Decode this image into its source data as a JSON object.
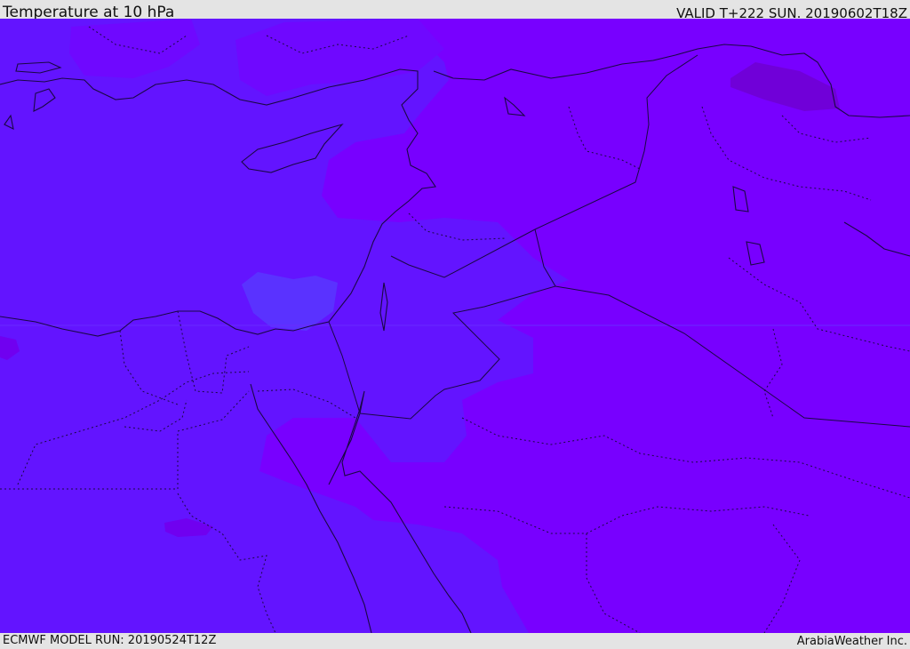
{
  "header": {
    "title": "Temperature at 10 hPa",
    "valid": "VALID T+222 SUN. 20190602T18Z"
  },
  "footer": {
    "model_run": "ECMWF MODEL RUN: 20190524T12Z",
    "credit": "ArabiaWeather Inc."
  },
  "colors": {
    "base_field": "#6314ff",
    "warmer_field": "#7a00ff",
    "cooler_field": "#5a2cff",
    "warmest_field": "#7000dd",
    "coastline": "#1a0844"
  }
}
